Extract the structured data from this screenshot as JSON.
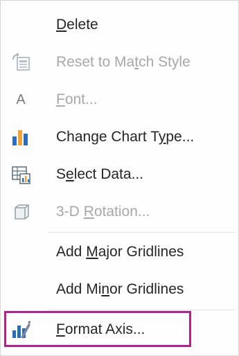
{
  "menu": {
    "items": [
      {
        "pre": "",
        "key": "D",
        "post": "elete",
        "icon": "none",
        "disabled": false
      },
      {
        "pre": "Reset to Ma",
        "key": "t",
        "post": "ch Style",
        "icon": "reset-style-icon",
        "disabled": true
      },
      {
        "pre": "",
        "key": "F",
        "post": "ont...",
        "icon": "font-icon",
        "disabled": true
      },
      {
        "pre": "Change Chart T",
        "key": "y",
        "post": "pe...",
        "icon": "change-chart-type-icon",
        "disabled": false
      },
      {
        "pre": "S",
        "key": "e",
        "post": "lect Data...",
        "icon": "select-data-icon",
        "disabled": false
      },
      {
        "pre": "3-D ",
        "key": "R",
        "post": "otation...",
        "icon": "3d-rotation-icon",
        "disabled": true
      },
      {
        "pre": "Add ",
        "key": "M",
        "post": "ajor Gridlines",
        "icon": "none",
        "disabled": false
      },
      {
        "pre": "Add Mi",
        "key": "n",
        "post": "or Gridlines",
        "icon": "none",
        "disabled": false
      },
      {
        "pre": "",
        "key": "F",
        "post": "ormat Axis...",
        "icon": "format-axis-icon",
        "disabled": false
      }
    ],
    "font_icon_glyph": "A",
    "highlight_color": "#b0238e"
  }
}
